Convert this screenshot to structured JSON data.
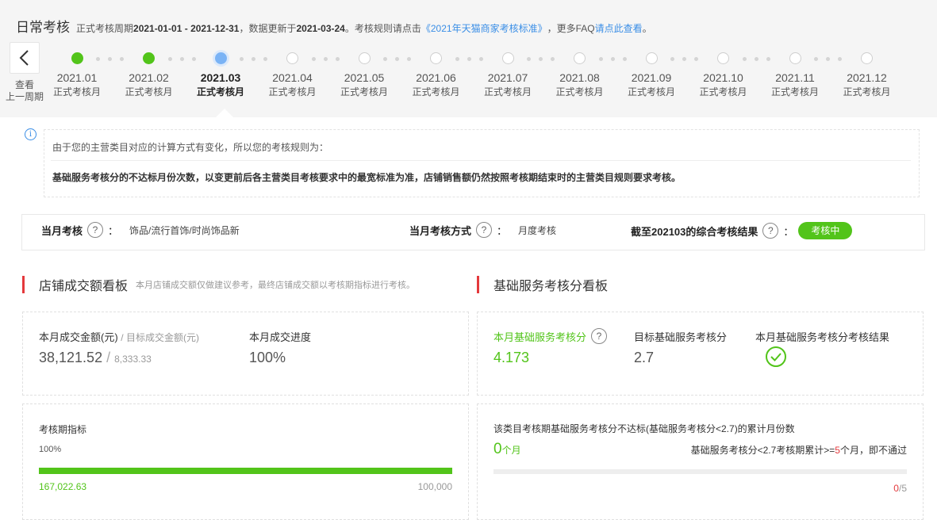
{
  "header": {
    "title": "日常考核",
    "period_prefix": "正式考核周期",
    "period": "2021-01-01 - 2021-12-31",
    "update_prefix": "，数据更新于",
    "update_date": "2021-03-24",
    "rule_prefix": "。考核规则请点击",
    "rule_link": "《2021年天猫商家考核标准》",
    "faq_prefix": "，更多FAQ",
    "faq_link": "请点此查看",
    "faq_suffix": "。"
  },
  "back": {
    "label_line1": "查看",
    "label_line2": "上一周期"
  },
  "timeline": [
    {
      "date": "2021.01",
      "sub": "正式考核月",
      "state": "done"
    },
    {
      "date": "2021.02",
      "sub": "正式考核月",
      "state": "done"
    },
    {
      "date": "2021.03",
      "sub": "正式考核月",
      "state": "current"
    },
    {
      "date": "2021.04",
      "sub": "正式考核月",
      "state": "future"
    },
    {
      "date": "2021.05",
      "sub": "正式考核月",
      "state": "future"
    },
    {
      "date": "2021.06",
      "sub": "正式考核月",
      "state": "future"
    },
    {
      "date": "2021.07",
      "sub": "正式考核月",
      "state": "future"
    },
    {
      "date": "2021.08",
      "sub": "正式考核月",
      "state": "future"
    },
    {
      "date": "2021.09",
      "sub": "正式考核月",
      "state": "future"
    },
    {
      "date": "2021.10",
      "sub": "正式考核月",
      "state": "future"
    },
    {
      "date": "2021.11",
      "sub": "正式考核月",
      "state": "future"
    },
    {
      "date": "2021.12",
      "sub": "正式考核月",
      "state": "future"
    }
  ],
  "notice": {
    "line1": "由于您的主营类目对应的计算方式有变化，所以您的考核规则为：",
    "line2": "基础服务考核分的不达标月份次数，以变更前后各主营类目考核要求中的最宽标准为准，店铺销售额仍然按照考核期结束时的主营类目规则要求考核。"
  },
  "summary": {
    "month_assess_label": "当月考核",
    "month_assess_value": "饰品/流行首饰/时尚饰品新",
    "method_label": "当月考核方式",
    "method_value": "月度考核",
    "result_label": "截至202103的综合考核结果",
    "result_badge": "考核中",
    "colon": "："
  },
  "sales_board": {
    "title": "店铺成交额看板",
    "note": "本月店铺成交额仅做建议参考，最终店铺成交额以考核期指标进行考核。",
    "amount_label": "本月成交金额(元)",
    "target_label": "/ 目标成交金额(元)",
    "amount_value": "38,121.52",
    "target_value": "8,333.33",
    "slash": "/",
    "progress_label": "本月成交进度",
    "progress_value": "100%",
    "period_label": "考核期指标",
    "period_percent": "100%",
    "period_fill": 1.0,
    "period_current": "167,022.63",
    "period_target": "100,000"
  },
  "service_board": {
    "title": "基础服务考核分看板",
    "score_label": "本月基础服务考核分",
    "score_value": "4.173",
    "target_label": "目标基础服务考核分",
    "target_value": "2.7",
    "result_label": "本月基础服务考核分考核结果",
    "fail_desc": "该类目考核期基础服务考核分不达标(基础服务考核分<2.7)的累计月份数",
    "fail_count": "0",
    "fail_unit": "个月",
    "rule_prefix": "基础服务考核分<2.7考核期累计>=",
    "rule_num": "5",
    "rule_suffix": "个月，即不通过",
    "ratio_current": "0",
    "ratio_total": "/5"
  },
  "colors": {
    "green": "#52c41a",
    "red": "#e4393c",
    "link": "#3a8ee6"
  }
}
